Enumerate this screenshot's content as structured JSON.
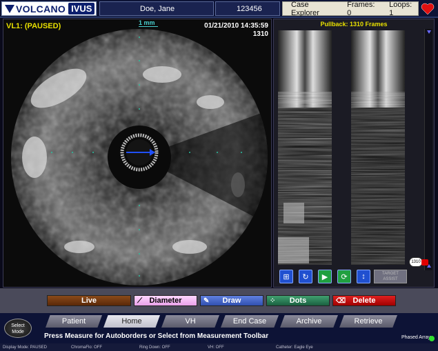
{
  "header": {
    "brand": "VOLCANO",
    "product": "IVUS",
    "patient_name": "Doe, Jane",
    "patient_id": "123456",
    "case_explorer": "Case Explorer",
    "frames": "Frames: 0",
    "loops": "Loops: 1",
    "heart_color": "#e01010"
  },
  "viewer": {
    "status": "VL1:  (PAUSED)",
    "scale": "1 mm",
    "datetime": "01/21/2010 14:35:59",
    "frame": "1310"
  },
  "longview": {
    "title": "Pullback: 1310 Frames",
    "slider_value": "1310",
    "target_assist": "TARGET ASSIST"
  },
  "toolbar": {
    "live": "Live",
    "diameter": "Diameter",
    "draw": "Draw",
    "dots": "Dots",
    "delete": "Delete"
  },
  "nav": {
    "select_mode": "Select Mode",
    "tabs": [
      "Patient",
      "Home",
      "VH",
      "End Case",
      "Archive",
      "Retrieve"
    ],
    "active_tab": "Home",
    "hint": "Press Measure for Autoborders or Select from Measurement Toolbar",
    "phased_array": "Phased Array"
  },
  "statusbar": {
    "display_mode": "Display Mode: PAUSED",
    "chromaflo": "ChromaFlo: OFF",
    "ring_down": "Ring Down: OFF",
    "vh": "VH: OFF",
    "catheter": "Catheter: Eagle Eye"
  }
}
